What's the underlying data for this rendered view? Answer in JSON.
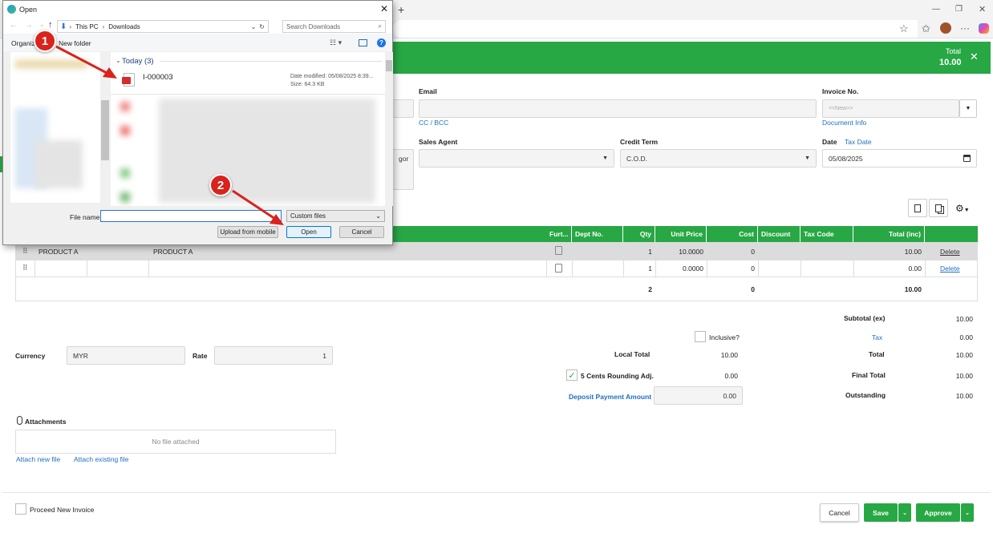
{
  "browser": {
    "new_tab_label": "+",
    "min_label": "—",
    "restore_label": "❐",
    "close_label": "✕",
    "star_glyph": "☆",
    "favorites_glyph": "✩",
    "more_glyph": "···"
  },
  "header": {
    "total_label": "Total",
    "total_value": "10.00",
    "close_glyph": "✕"
  },
  "form": {
    "email_label": "Email",
    "email_value": "",
    "cc_bcc_link": "CC / BCC",
    "invoice_no_label": "Invoice No.",
    "invoice_no_placeholder": "<<New>>",
    "document_info_link": "Document Info",
    "sales_agent_label": "Sales Agent",
    "sales_agent_value": "",
    "credit_term_label": "Credit Term",
    "credit_term_value": "C.O.D.",
    "date_label": "Date",
    "tax_date_link": "Tax Date",
    "date_value": "05/08/2025",
    "partial_gor": "gor"
  },
  "table": {
    "headers": [
      "Furt...",
      "Dept No.",
      "Qty",
      "Unit Price",
      "Cost",
      "Discount",
      "Tax Code",
      "Total (inc)"
    ],
    "rows": [
      {
        "code": "PRODUCT A",
        "desc": "PRODUCT A",
        "qty": "1",
        "unit_price": "10.0000",
        "cost": "0",
        "total": "10.00",
        "action": "Delete"
      },
      {
        "code": "",
        "desc": "",
        "qty": "1",
        "unit_price": "0.0000",
        "cost": "0",
        "total": "0.00",
        "action": "Delete"
      }
    ],
    "footer": {
      "qty": "2",
      "cost": "0",
      "total": "10.00"
    }
  },
  "summary": {
    "subtotal_label": "Subtotal (ex)",
    "subtotal_value": "10.00",
    "inclusive_label": "Inclusive?",
    "tax_label": "Tax",
    "tax_value": "0.00",
    "local_total_label": "Local Total",
    "local_total_value": "10.00",
    "total_label": "Total",
    "total_value": "10.00",
    "rounding_label": "5 Cents Rounding Adj.",
    "rounding_value": "0.00",
    "final_total_label": "Final Total",
    "final_total_value": "10.00",
    "deposit_label": "Deposit Payment Amount",
    "deposit_value": "0.00",
    "outstanding_label": "Outstanding",
    "outstanding_value": "10.00"
  },
  "currency": {
    "currency_label": "Currency",
    "currency_value": "MYR",
    "rate_label": "Rate",
    "rate_value": "1"
  },
  "attachments": {
    "title": "Attachments",
    "empty_text": "No file attached",
    "attach_new": "Attach new file",
    "attach_existing": "Attach existing file"
  },
  "footer": {
    "proceed_label": "Proceed New Invoice",
    "cancel_label": "Cancel",
    "save_label": "Save",
    "approve_label": "Approve"
  },
  "dialog": {
    "title": "Open",
    "breadcrumb_this_pc": "This PC",
    "breadcrumb_downloads": "Downloads",
    "search_placeholder": "Search Downloads",
    "organize_label": "Organize",
    "new_folder_label": "New folder",
    "group_label": "Today (3)",
    "file_name": "I-000003",
    "file_date": "Date modified: 05/08/2025 8:39...",
    "file_size": "Size: 64.3 KB",
    "file_name_label": "File name:",
    "file_name_value": "",
    "file_type_value": "Custom files",
    "upload_mobile_label": "Upload from mobile",
    "open_label": "Open",
    "cancel_label": "Cancel"
  },
  "markers": {
    "one": "1",
    "two": "2"
  },
  "colors": {
    "brand_green": "#28a745",
    "link_blue": "#1f6fc0",
    "marker_red": "#d9231c"
  }
}
